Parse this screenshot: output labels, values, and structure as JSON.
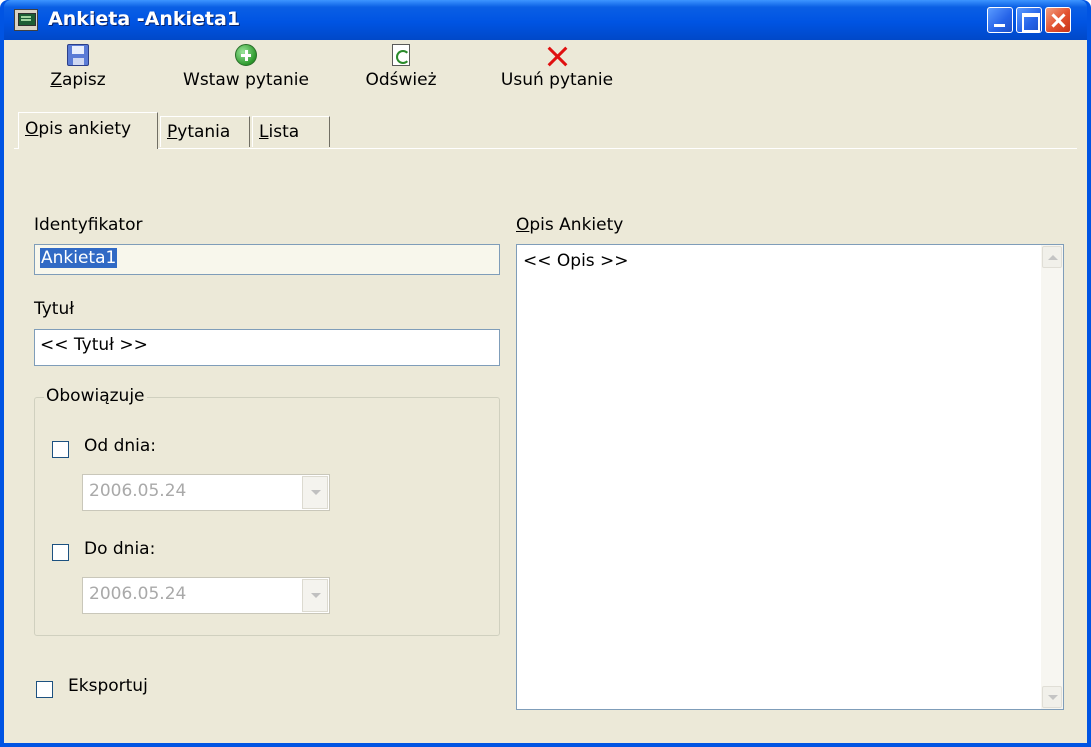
{
  "window": {
    "title": "Ankieta -Ankieta1"
  },
  "toolbar": {
    "items": [
      {
        "label_first": "Z",
        "label_rest": "apisz",
        "icon": "save-icon"
      },
      {
        "label": "Wstaw pytanie",
        "icon": "add-icon"
      },
      {
        "label": "Odśwież",
        "icon": "refresh-icon"
      },
      {
        "label": "Usuń pytanie",
        "icon": "delete-icon"
      }
    ]
  },
  "tabs": [
    {
      "label_first": "O",
      "label_rest": "pis ankiety",
      "active": true
    },
    {
      "label_first": "P",
      "label_rest": "ytania",
      "active": false
    },
    {
      "label_first": "L",
      "label_rest": "ista",
      "active": false
    }
  ],
  "form": {
    "identyfikator_label": "Identyfikator",
    "identyfikator_value": "Ankieta1",
    "tytul_label": "Tytuł",
    "tytul_value": "<< Tytuł >>",
    "group_label": "Obowiązuje",
    "od_dnia_label": "Od dnia:",
    "od_dnia_value": "2006.05.24",
    "od_dnia_checked": false,
    "do_dnia_label": "Do dnia:",
    "do_dnia_value": "2006.05.24",
    "do_dnia_checked": false,
    "eksportuj_label": "Eksportuj",
    "eksportuj_checked": false,
    "opis_label_first": "O",
    "opis_label_rest": "pis Ankiety",
    "opis_value": "<< Opis >>"
  },
  "colors": {
    "titlebar": "#0054e3",
    "face": "#ece9d8",
    "selection": "#316ac5",
    "close_button": "#e2502e"
  }
}
